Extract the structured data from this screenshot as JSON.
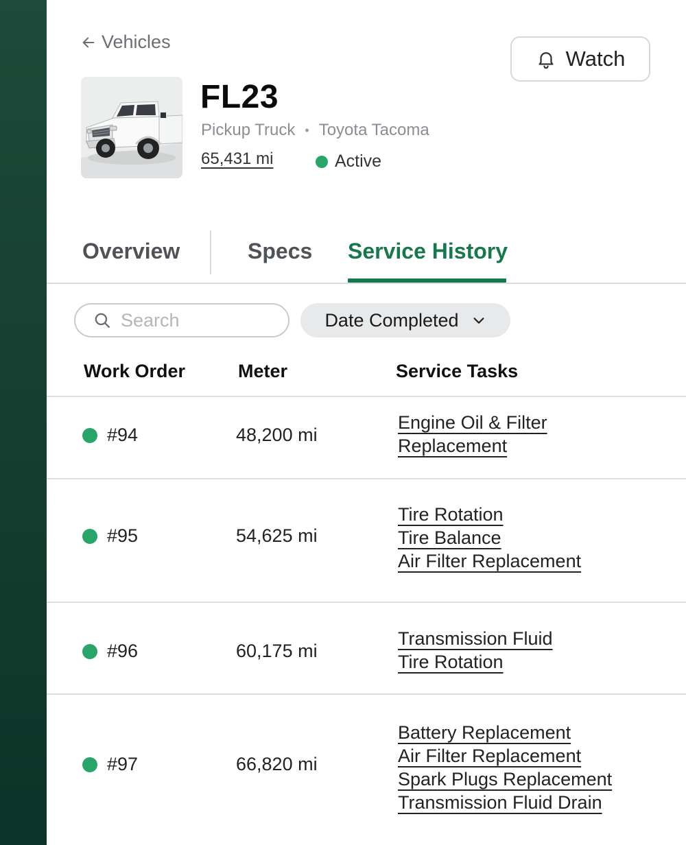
{
  "header": {
    "back_label": "Vehicles",
    "watch_label": "Watch",
    "vehicle_name": "FL23",
    "vehicle_type": "Pickup Truck",
    "separator": "•",
    "vehicle_model": "Toyota Tacoma",
    "meter": "65,431 mi",
    "status": "Active"
  },
  "tabs": [
    {
      "label": "Overview",
      "active": false
    },
    {
      "label": "Specs",
      "active": false
    },
    {
      "label": "Service History",
      "active": true
    }
  ],
  "toolbar": {
    "search_placeholder": "Search",
    "filter_label": "Date Completed"
  },
  "table": {
    "columns": [
      "Work Order",
      "Meter",
      "Service Tasks"
    ],
    "rows": [
      {
        "work_order": "#94",
        "meter": "48,200 mi",
        "tasks": [
          "Engine Oil & Filter",
          "Replacement"
        ]
      },
      {
        "work_order": "#95",
        "meter": "54,625 mi",
        "tasks": [
          "Tire Rotation",
          "Tire Balance",
          "Air Filter Replacement"
        ]
      },
      {
        "work_order": "#96",
        "meter": "60,175 mi",
        "tasks": [
          "Transmission Fluid",
          "Tire Rotation"
        ]
      },
      {
        "work_order": "#97",
        "meter": "66,820 mi",
        "tasks": [
          "Battery Replacement",
          "Air Filter Replacement",
          "Spark Plugs Replacement",
          "Transmission Fluid Drain"
        ]
      }
    ]
  },
  "colors": {
    "accent": "#17784e",
    "status_green": "#2aa56a",
    "sidebar": "#123f30"
  }
}
